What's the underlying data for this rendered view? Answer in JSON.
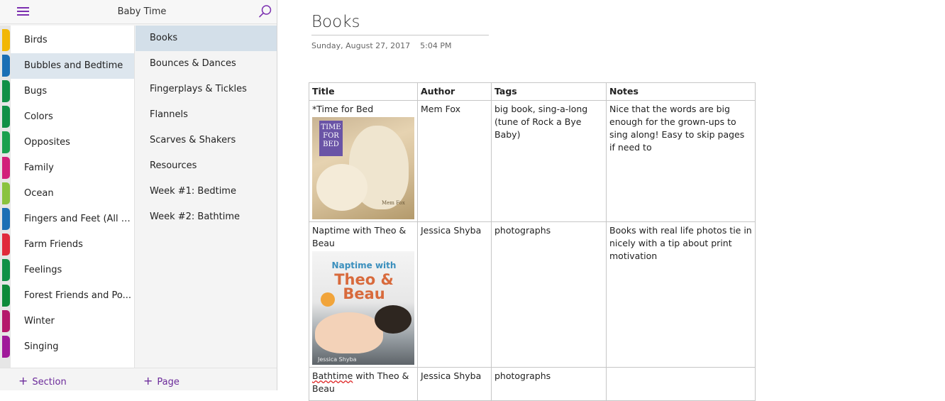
{
  "notebook": {
    "title": "Baby Time"
  },
  "sections": [
    {
      "label": "Birds",
      "color": "#f2b705"
    },
    {
      "label": "Bubbles and Bedtime",
      "color": "#1b6fb5",
      "selected": true
    },
    {
      "label": "Bugs",
      "color": "#109046"
    },
    {
      "label": "Colors",
      "color": "#109046"
    },
    {
      "label": "Opposites",
      "color": "#1aa04e"
    },
    {
      "label": "Family",
      "color": "#d21f7a"
    },
    {
      "label": "Ocean",
      "color": "#8ac33e"
    },
    {
      "label": "Fingers and Feet (All A...",
      "color": "#1b6fb5"
    },
    {
      "label": "Farm Friends",
      "color": "#e02a3b"
    },
    {
      "label": "Feelings",
      "color": "#109046"
    },
    {
      "label": "Forest Friends and Po...",
      "color": "#0e8a3a"
    },
    {
      "label": "Winter",
      "color": "#b5186b"
    },
    {
      "label": "Singing",
      "color": "#a0199a"
    }
  ],
  "pages": [
    {
      "label": "Books",
      "selected": true
    },
    {
      "label": "Bounces & Dances"
    },
    {
      "label": "Fingerplays & Tickles"
    },
    {
      "label": "Flannels"
    },
    {
      "label": "Scarves & Shakers"
    },
    {
      "label": "Resources"
    },
    {
      "label": "Week #1: Bedtime"
    },
    {
      "label": "Week #2: Bathtime"
    }
  ],
  "bottom": {
    "add_section": "Section",
    "add_page": "Page"
  },
  "page": {
    "title": "Books",
    "date": "Sunday, August 27, 2017",
    "time": "5:04 PM"
  },
  "table": {
    "headers": [
      "Title",
      "Author",
      "Tags",
      "Notes"
    ],
    "rows": [
      {
        "title": "*Time for Bed",
        "author": "Mem Fox",
        "tags": "big book, sing-a-long (tune of Rock a Bye Baby)",
        "notes": "Nice that the words are big enough for the grown-ups to sing along!  Easy to skip pages if need to",
        "cover": {
          "line1": "TIME",
          "line2": "FOR",
          "line3": "BED",
          "author": "Mem Fox"
        }
      },
      {
        "title": "Naptime with Theo & Beau",
        "author": "Jessica Shyba",
        "tags": "photographs",
        "notes": "Books with real life photos tie in nicely with a tip about print motivation",
        "cover": {
          "line1": "Naptime with",
          "line2": "Theo & Beau",
          "author": "Jessica Shyba"
        }
      },
      {
        "title_a": "Bathtime",
        "title_b": " with Theo & Beau",
        "author": "Jessica Shyba",
        "tags": "photographs",
        "notes": ""
      }
    ]
  },
  "icons": {
    "menu": "hamburger-icon",
    "search": "search-icon",
    "add": "plus-icon"
  },
  "colors": {
    "accent": "#7b2fb0",
    "selected_section": "#dde6ee",
    "selected_page": "#d3dfe9"
  }
}
